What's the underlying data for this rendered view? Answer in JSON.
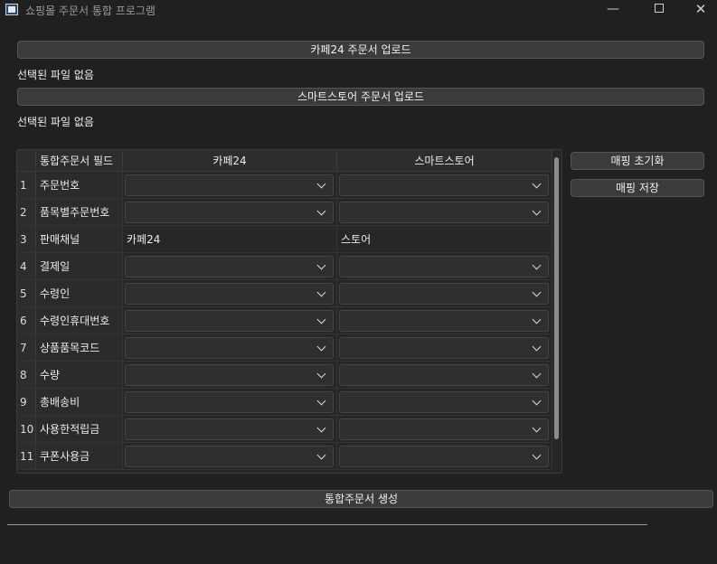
{
  "window": {
    "title": "쇼핑몰 주문서 통합 프로그램",
    "controls": {
      "minimize": "—",
      "close": "✕"
    }
  },
  "upload": {
    "cafe24_button": "카페24 주문서 업로드",
    "cafe24_status": "선택된 파일 없음",
    "smartstore_button": "스마트스토어 주문서 업로드",
    "smartstore_status": "선택된 파일 없음"
  },
  "mapping_table": {
    "headers": {
      "field": "통합주문서 필드",
      "cafe24": "카페24",
      "smartstore": "스마트스토어"
    },
    "rows": [
      {
        "num": "1",
        "field": "주문번호",
        "cafe24": "",
        "smartstore": "",
        "type": "combo"
      },
      {
        "num": "2",
        "field": "품목별주문번호",
        "cafe24": "",
        "smartstore": "",
        "type": "combo"
      },
      {
        "num": "3",
        "field": "판매채널",
        "cafe24": "카페24",
        "smartstore": "스토어",
        "type": "text"
      },
      {
        "num": "4",
        "field": "결제일",
        "cafe24": "",
        "smartstore": "",
        "type": "combo"
      },
      {
        "num": "5",
        "field": "수령인",
        "cafe24": "",
        "smartstore": "",
        "type": "combo"
      },
      {
        "num": "6",
        "field": "수령인휴대번호",
        "cafe24": "",
        "smartstore": "",
        "type": "combo"
      },
      {
        "num": "7",
        "field": "상품품목코드",
        "cafe24": "",
        "smartstore": "",
        "type": "combo"
      },
      {
        "num": "8",
        "field": "수량",
        "cafe24": "",
        "smartstore": "",
        "type": "combo"
      },
      {
        "num": "9",
        "field": "총배송비",
        "cafe24": "",
        "smartstore": "",
        "type": "combo"
      },
      {
        "num": "10",
        "field": "사용한적립금",
        "cafe24": "",
        "smartstore": "",
        "type": "combo"
      },
      {
        "num": "11",
        "field": "쿠폰사용금",
        "cafe24": "",
        "smartstore": "",
        "type": "combo"
      }
    ]
  },
  "side_buttons": {
    "reset": "매핑 초기화",
    "save": "매핑 저장"
  },
  "generate_button": "통합주문서 생성",
  "colors": {
    "background": "#202020",
    "button": "#3b3b3b",
    "border": "#555555"
  }
}
